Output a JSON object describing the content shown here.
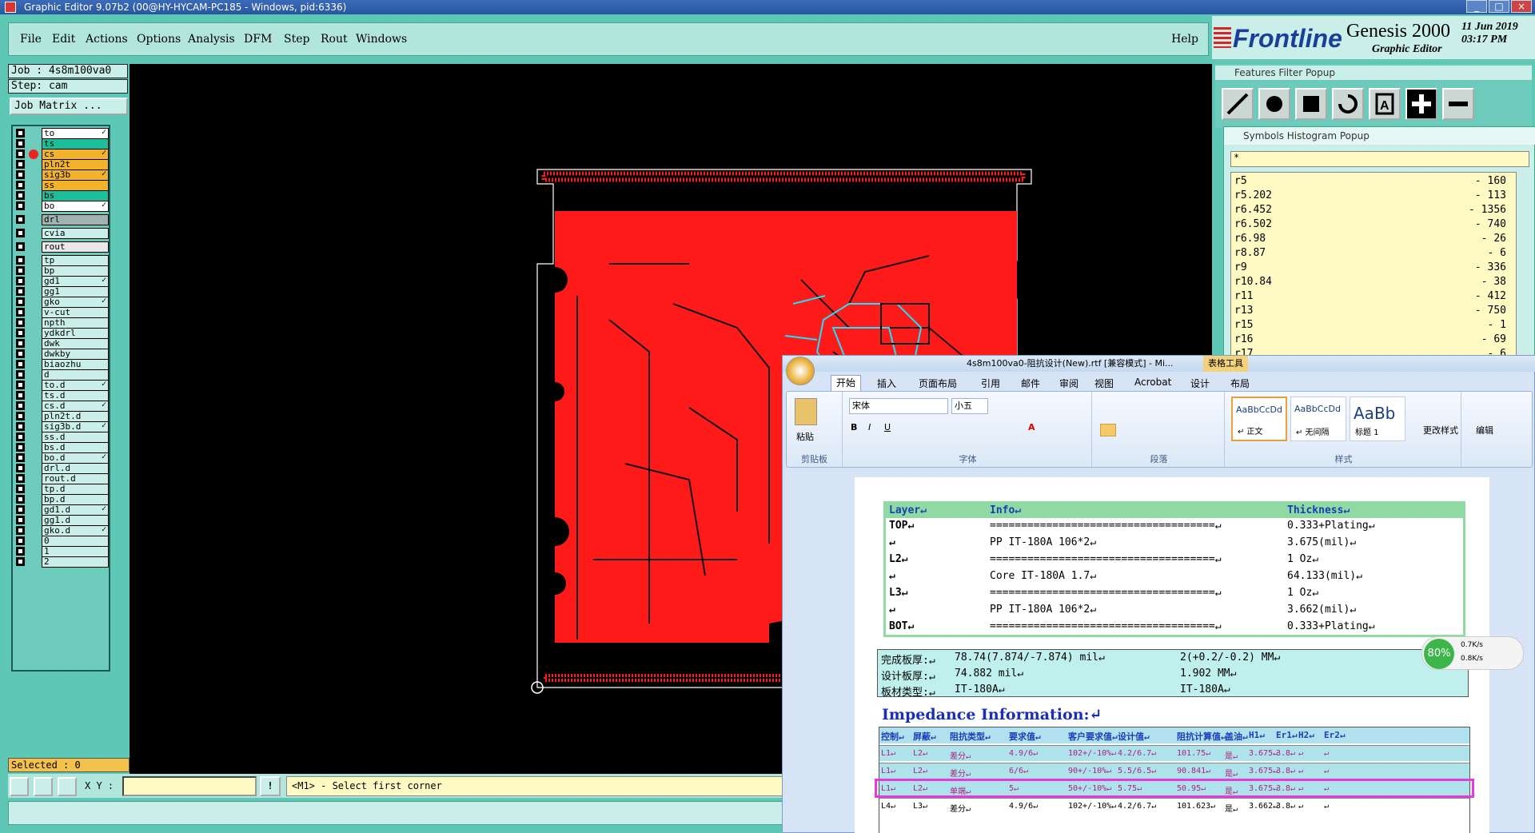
{
  "window": {
    "title": "Graphic Editor 9.07b2 (00@HY-HYCAM-PC185 - Windows, pid:6336)"
  },
  "menu": {
    "items": [
      "File",
      "Edit",
      "Actions",
      "Options",
      "Analysis",
      "DFM",
      "Step",
      "Rout",
      "Windows"
    ],
    "help": "Help"
  },
  "logo": {
    "brand": "Frontline",
    "product": "Genesis 2000",
    "sub": "Graphic Editor",
    "date": "11 Jun 2019",
    "time": "03:17 PM"
  },
  "job": {
    "job_label": "Job : 4s8m100va0",
    "step_label": "Step: cam",
    "matrix_button": "Job Matrix ..."
  },
  "layers": [
    {
      "name": "to",
      "color": "#ffffff",
      "flag": "✓"
    },
    {
      "name": "ts",
      "color": "#1dbf9a",
      "flag": ""
    },
    {
      "name": "cs",
      "color": "#f2b22a",
      "flag": "✓",
      "active": true
    },
    {
      "name": "pln2t",
      "color": "#f2b22a",
      "flag": ""
    },
    {
      "name": "sig3b",
      "color": "#f2b22a",
      "flag": "✓"
    },
    {
      "name": "ss",
      "color": "#f2b22a",
      "flag": ""
    },
    {
      "name": "bs",
      "color": "#1dbf9a",
      "flag": ""
    },
    {
      "name": "bo",
      "color": "#ffffff",
      "flag": "✓"
    },
    {
      "name": "drl",
      "color": "#9fb4b0",
      "flag": "",
      "gap": true
    },
    {
      "name": "cvia",
      "color": "#c9efe8",
      "flag": "",
      "gap": true
    },
    {
      "name": "rout",
      "color": "#e8e8e8",
      "flag": "",
      "gap": true
    },
    {
      "name": "tp",
      "color": "#c9efe8",
      "flag": "",
      "gap": true
    },
    {
      "name": "bp",
      "color": "#c9efe8",
      "flag": ""
    },
    {
      "name": "gd1",
      "color": "#c9efe8",
      "flag": "✓"
    },
    {
      "name": "gg1",
      "color": "#c9efe8",
      "flag": ""
    },
    {
      "name": "gko",
      "color": "#c9efe8",
      "flag": "✓"
    },
    {
      "name": "v-cut",
      "color": "#c9efe8",
      "flag": ""
    },
    {
      "name": "npth",
      "color": "#c9efe8",
      "flag": ""
    },
    {
      "name": "ydkdrl",
      "color": "#c9efe8",
      "flag": ""
    },
    {
      "name": "dwk",
      "color": "#c9efe8",
      "flag": ""
    },
    {
      "name": "dwkby",
      "color": "#c9efe8",
      "flag": ""
    },
    {
      "name": "biaozhu",
      "color": "#c9efe8",
      "flag": ""
    },
    {
      "name": "d",
      "color": "#c9efe8",
      "flag": ""
    },
    {
      "name": "to.d",
      "color": "#c9efe8",
      "flag": "✓"
    },
    {
      "name": "ts.d",
      "color": "#c9efe8",
      "flag": ""
    },
    {
      "name": "cs.d",
      "color": "#c9efe8",
      "flag": "✓"
    },
    {
      "name": "pln2t.d",
      "color": "#c9efe8",
      "flag": ""
    },
    {
      "name": "sig3b.d",
      "color": "#c9efe8",
      "flag": "✓"
    },
    {
      "name": "ss.d",
      "color": "#c9efe8",
      "flag": ""
    },
    {
      "name": "bs.d",
      "color": "#c9efe8",
      "flag": ""
    },
    {
      "name": "bo.d",
      "color": "#c9efe8",
      "flag": "✓"
    },
    {
      "name": "drl.d",
      "color": "#c9efe8",
      "flag": ""
    },
    {
      "name": "rout.d",
      "color": "#c9efe8",
      "flag": ""
    },
    {
      "name": "tp.d",
      "color": "#c9efe8",
      "flag": ""
    },
    {
      "name": "bp.d",
      "color": "#c9efe8",
      "flag": ""
    },
    {
      "name": "gd1.d",
      "color": "#c9efe8",
      "flag": "✓"
    },
    {
      "name": "gg1.d",
      "color": "#c9efe8",
      "flag": ""
    },
    {
      "name": "gko.d",
      "color": "#c9efe8",
      "flag": "✓"
    },
    {
      "name": "0",
      "color": "#c9efe8",
      "flag": ""
    },
    {
      "name": "1",
      "color": "#c9efe8",
      "flag": ""
    },
    {
      "name": "2",
      "color": "#c9efe8",
      "flag": ""
    }
  ],
  "selected": "Selected : 0",
  "bottom": {
    "xy_label": "X Y :",
    "xy_value": "",
    "prompt": "<M1> - Select first corner",
    "exclaim": "!"
  },
  "features_filter": {
    "title": "Features Filter Popup"
  },
  "histogram": {
    "title": "Symbols Histogram Popup",
    "filter": "*",
    "rows": [
      {
        "sym": "r5",
        "count": "- 160"
      },
      {
        "sym": "r5.202",
        "count": "- 113"
      },
      {
        "sym": "r6.452",
        "count": "- 1356"
      },
      {
        "sym": "r6.502",
        "count": "- 740"
      },
      {
        "sym": "r6.98",
        "count": "- 26"
      },
      {
        "sym": "r8.87",
        "count": "- 6"
      },
      {
        "sym": "r9",
        "count": "- 336"
      },
      {
        "sym": "r10.84",
        "count": "- 38"
      },
      {
        "sym": "r11",
        "count": "- 412"
      },
      {
        "sym": "r13",
        "count": "- 750"
      },
      {
        "sym": "r15",
        "count": "- 1"
      },
      {
        "sym": "r16",
        "count": "- 69"
      },
      {
        "sym": "r17",
        "count": "- 6"
      }
    ]
  },
  "word": {
    "title": "4s8m100va0-阻抗设计(New).rtf [兼容模式] - Mi...",
    "context_tab": "表格工具",
    "tabs": [
      "开始",
      "插入",
      "页面布局",
      "引用",
      "邮件",
      "审阅",
      "视图",
      "Acrobat",
      "设计",
      "布局"
    ],
    "font_name": "宋体",
    "font_size": "小五",
    "groups": {
      "clipboard": "剪贴板",
      "font": "字体",
      "paragraph": "段落",
      "styles": "样式"
    },
    "paste": "粘贴",
    "styles": [
      {
        "preview": "AaBbCcDd",
        "name": "↵ 正文"
      },
      {
        "preview": "AaBbCcDd",
        "name": "↵ 无间隔"
      },
      {
        "preview": "AaBb",
        "name": "标题 1"
      }
    ],
    "change_styles": "更改样式",
    "edit": "编辑",
    "layer_table": {
      "headers": [
        "Layer↵",
        "Info↵",
        "Thickness↵"
      ],
      "rows": [
        {
          "layer": "TOP↵",
          "info": "====================================↵",
          "thick": "0.333+Plating↵"
        },
        {
          "layer": "↵",
          "info": "PP     IT-180A    106*2↵",
          "thick": "3.675(mil)↵"
        },
        {
          "layer": "L2↵",
          "info": "====================================↵",
          "thick": "1 Oz↵"
        },
        {
          "layer": "↵",
          "info": "Core     IT-180A    1.7↵",
          "thick": "64.133(mil)↵"
        },
        {
          "layer": "L3↵",
          "info": "====================================↵",
          "thick": "1 Oz↵"
        },
        {
          "layer": "↵",
          "info": "PP     IT-180A    106*2↵",
          "thick": "3.662(mil)↵"
        },
        {
          "layer": "BOT↵",
          "info": "====================================↵",
          "thick": "0.333+Plating↵"
        }
      ]
    },
    "props": [
      {
        "k": "完成板厚:↵",
        "v": "78.74(7.874/-7.874) mil↵",
        "v2": "2(+0.2/-0.2) MM↵"
      },
      {
        "k": "设计板厚:↵",
        "v": "74.882 mil↵",
        "v2": "1.902 MM↵"
      },
      {
        "k": "板材类型:↵",
        "v": "IT-180A↵",
        "v2": "IT-180A↵"
      }
    ],
    "impedance_title": "Impedance Information:↵",
    "imp_headers": [
      "控制↵",
      "屏蔽↵",
      "阻抗类型↵",
      "要求值↵",
      "客户要求值↵",
      "设计值↵",
      "阻抗计算值↵",
      "盖油↵",
      "H1↵",
      "Er1↵",
      "H2↵",
      "Er2↵"
    ],
    "imp_rows": [
      [
        "L1↵",
        "L2↵",
        "差分↵",
        "4.9/6↵",
        "102+/-10%↵",
        "4.2/6.7↵",
        "101.75↵",
        "是↵",
        "3.675↵",
        "3.8↵",
        "↵",
        "↵"
      ],
      [
        "L1↵",
        "L2↵",
        "差分↵",
        "6/6↵",
        "90+/-10%↵",
        "5.5/6.5↵",
        "90.841↵",
        "是↵",
        "3.675↵",
        "3.8↵",
        "↵",
        "↵"
      ],
      [
        "L1↵",
        "L2↵",
        "单端↵",
        "5↵",
        "50+/-10%↵",
        "5.75↵",
        "50.95↵",
        "是↵",
        "3.675↵",
        "3.8↵",
        "↵",
        "↵"
      ],
      [
        "L4↵",
        "L3↵",
        "差分↵",
        "4.9/6↵",
        "102+/-10%↵",
        "4.2/6.7↵",
        "101.623↵",
        "是↵",
        "3.662↵",
        "3.8↵",
        "↵",
        "↵"
      ]
    ]
  },
  "net_monitor": {
    "percent": "80%",
    "up": "0.7K/s",
    "down": "0.8K/s"
  }
}
